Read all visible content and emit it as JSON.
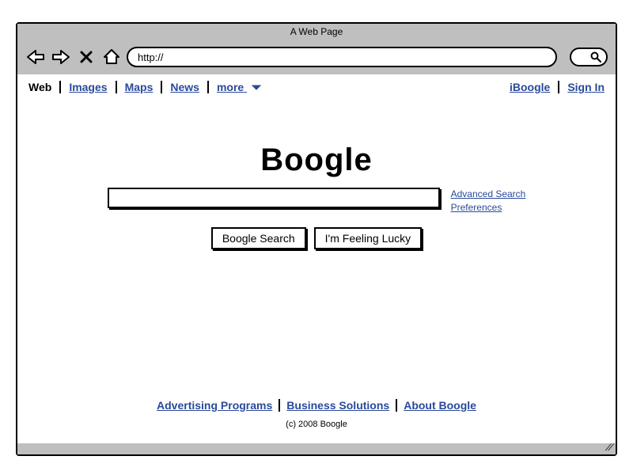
{
  "window": {
    "title": "A Web Page",
    "url": "http://"
  },
  "topnav": {
    "left": [
      {
        "label": "Web",
        "active": true
      },
      {
        "label": "Images",
        "active": false
      },
      {
        "label": "Maps",
        "active": false
      },
      {
        "label": "News",
        "active": false
      },
      {
        "label": "more",
        "active": false,
        "dropdown": true
      }
    ],
    "right": [
      {
        "label": "iBoogle"
      },
      {
        "label": "Sign In"
      }
    ]
  },
  "logo": "Boogle",
  "search": {
    "value": "",
    "buttons": {
      "search": "Boogle Search",
      "lucky": "I'm Feeling Lucky"
    },
    "side_links": {
      "advanced": "Advanced Search",
      "preferences": "Preferences"
    }
  },
  "footer": {
    "links": {
      "advertising": "Advertising Programs",
      "business": "Business Solutions",
      "about": "About Boogle"
    },
    "copyright": "(c) 2008 Boogle"
  }
}
